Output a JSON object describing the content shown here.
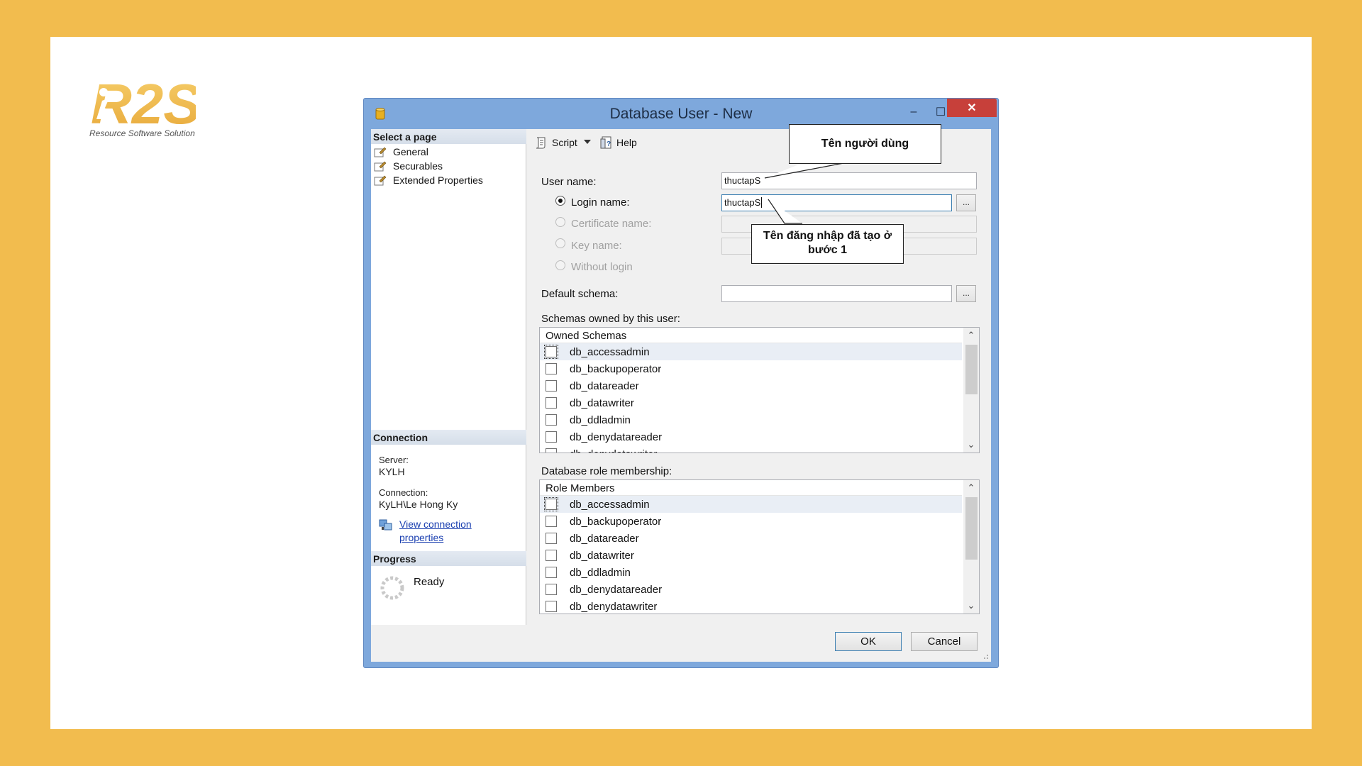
{
  "logo": {
    "mark": "R2S",
    "tagline": "Resource Software Solution"
  },
  "window": {
    "title": "Database User - New",
    "minimize": "–",
    "maximize": "☐",
    "close": "✕"
  },
  "select_page": {
    "header": "Select a page",
    "items": [
      {
        "label": "General",
        "icon": "wrench-page-icon"
      },
      {
        "label": "Securables",
        "icon": "wrench-page-icon"
      },
      {
        "label": "Extended Properties",
        "icon": "wrench-page-icon"
      }
    ]
  },
  "connection": {
    "header": "Connection",
    "server_label": "Server:",
    "server_value": "KYLH",
    "connection_label": "Connection:",
    "connection_value": "KyLH\\Le Hong Ky",
    "view_link_line1": "View connection",
    "view_link_line2": "properties"
  },
  "progress": {
    "header": "Progress",
    "status": "Ready"
  },
  "toolbar": {
    "script": "Script",
    "help": "Help"
  },
  "form": {
    "user_name_label": "User name:",
    "user_name_value": "thuctapS",
    "login_name_label": "Login name:",
    "login_name_value": "thuctapS",
    "certificate_name_label": "Certificate name:",
    "key_name_label": "Key name:",
    "without_login_label": "Without login",
    "default_schema_label": "Default schema:",
    "default_schema_value": "",
    "ellipsis": "..."
  },
  "schemas": {
    "label": "Schemas owned by this user:",
    "header": "Owned Schemas",
    "rows": [
      "db_accessadmin",
      "db_backupoperator",
      "db_datareader",
      "db_datawriter",
      "db_ddladmin",
      "db_denydatareader",
      "db_denydatawriter"
    ]
  },
  "roles": {
    "label": "Database role membership:",
    "header": "Role Members",
    "rows": [
      "db_accessadmin",
      "db_backupoperator",
      "db_datareader",
      "db_datawriter",
      "db_ddladmin",
      "db_denydatareader",
      "db_denydatawriter"
    ]
  },
  "buttons": {
    "ok": "OK",
    "cancel": "Cancel"
  },
  "callouts": {
    "user": "Tên người dùng",
    "login_line1": "Tên đăng nhập đã tạo ở",
    "login_line2": "bước 1"
  },
  "colors": {
    "background": "#F2BC4E",
    "window_frame": "#7EA8DC",
    "close_button": "#C7403A",
    "link": "#1a3fb0"
  }
}
